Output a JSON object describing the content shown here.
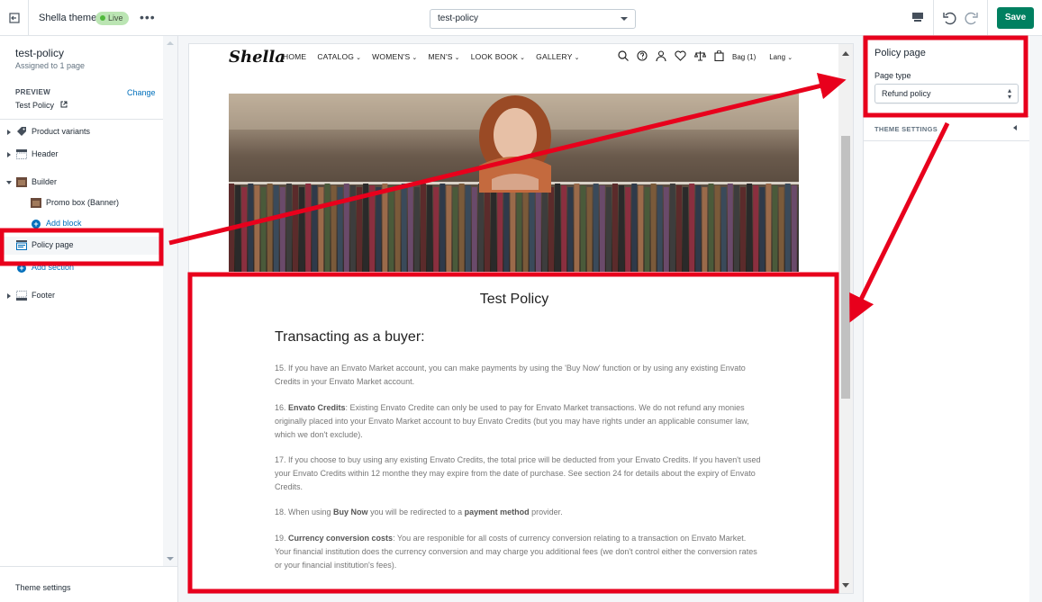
{
  "topbar": {
    "theme_name": "Shella theme",
    "live_badge": "Live",
    "more_label": "•••",
    "template_select": "test-policy",
    "save_label": "Save"
  },
  "sidebar": {
    "title": "test-policy",
    "subtitle": "Assigned to 1 page",
    "preview_heading": "PREVIEW",
    "change_link": "Change",
    "preview_value": "Test Policy",
    "sections": {
      "product_variants": "Product variants",
      "header": "Header",
      "builder": "Builder",
      "promo_box": "Promo box (Banner)",
      "add_block": "Add block",
      "policy_page": "Policy page",
      "add_section": "Add section",
      "footer": "Footer"
    },
    "theme_settings": "Theme settings"
  },
  "preview": {
    "logo": "Shella",
    "nav": [
      "HOME",
      "CATALOG",
      "WOMEN'S",
      "MEN'S",
      "LOOK BOOK",
      "GALLERY"
    ],
    "nav_dropdowns": [
      false,
      true,
      true,
      true,
      true,
      true
    ],
    "bag_label": "Bag (1)",
    "lang_label": "Lang",
    "page_title": "Test Policy",
    "policy_heading": "Transacting as a buyer:",
    "paragraphs": [
      {
        "pre": "15. If you have an Envato Market account, you can make payments by using the 'Buy Now' function or by using any existing Envato Credits in your Envato Market account.",
        "bold": "",
        "post": ""
      },
      {
        "pre": "16. ",
        "bold": "Envato Credits",
        "post": ": Existing Envato Credite can only be used to pay for Envato Market transactions. We do not refund any monies originally placed into your Envato Market account to buy Envato Credits (but you may have rights under an applicable consumer law, which we don't exclude)."
      },
      {
        "pre": "17. If you choose to buy using any existing Envato Credits, the total price will be deducted from your Envato Credits. If you haven't used your Envato Credits within 12 monthe they may expire from the date of purchase. See section 24 for details about the expiry of Envato Credits.",
        "bold": "",
        "post": ""
      }
    ],
    "para18": {
      "a": "18. When using ",
      "b": "Buy Now",
      "c": " you will be redirected to a ",
      "d": "payment method",
      "e": " provider."
    },
    "para19": {
      "a": "19. ",
      "b": "Currency conversion costs",
      "c": ": You are responible for all costs of currency conversion relating to a transaction on Envato Market. Your financial institution does the currency conversion and may charge you additional fees (we don't control either the conversion rates or your financial institution's fees)."
    }
  },
  "right_panel": {
    "title": "Policy page",
    "page_type_label": "Page type",
    "page_type_value": "Refund policy",
    "theme_settings": "THEME SETTINGS"
  },
  "colors": {
    "accent": "#008060",
    "link": "#006fbb",
    "annotation": "#e8001c",
    "live_badge_bg": "#bbe5b3"
  }
}
